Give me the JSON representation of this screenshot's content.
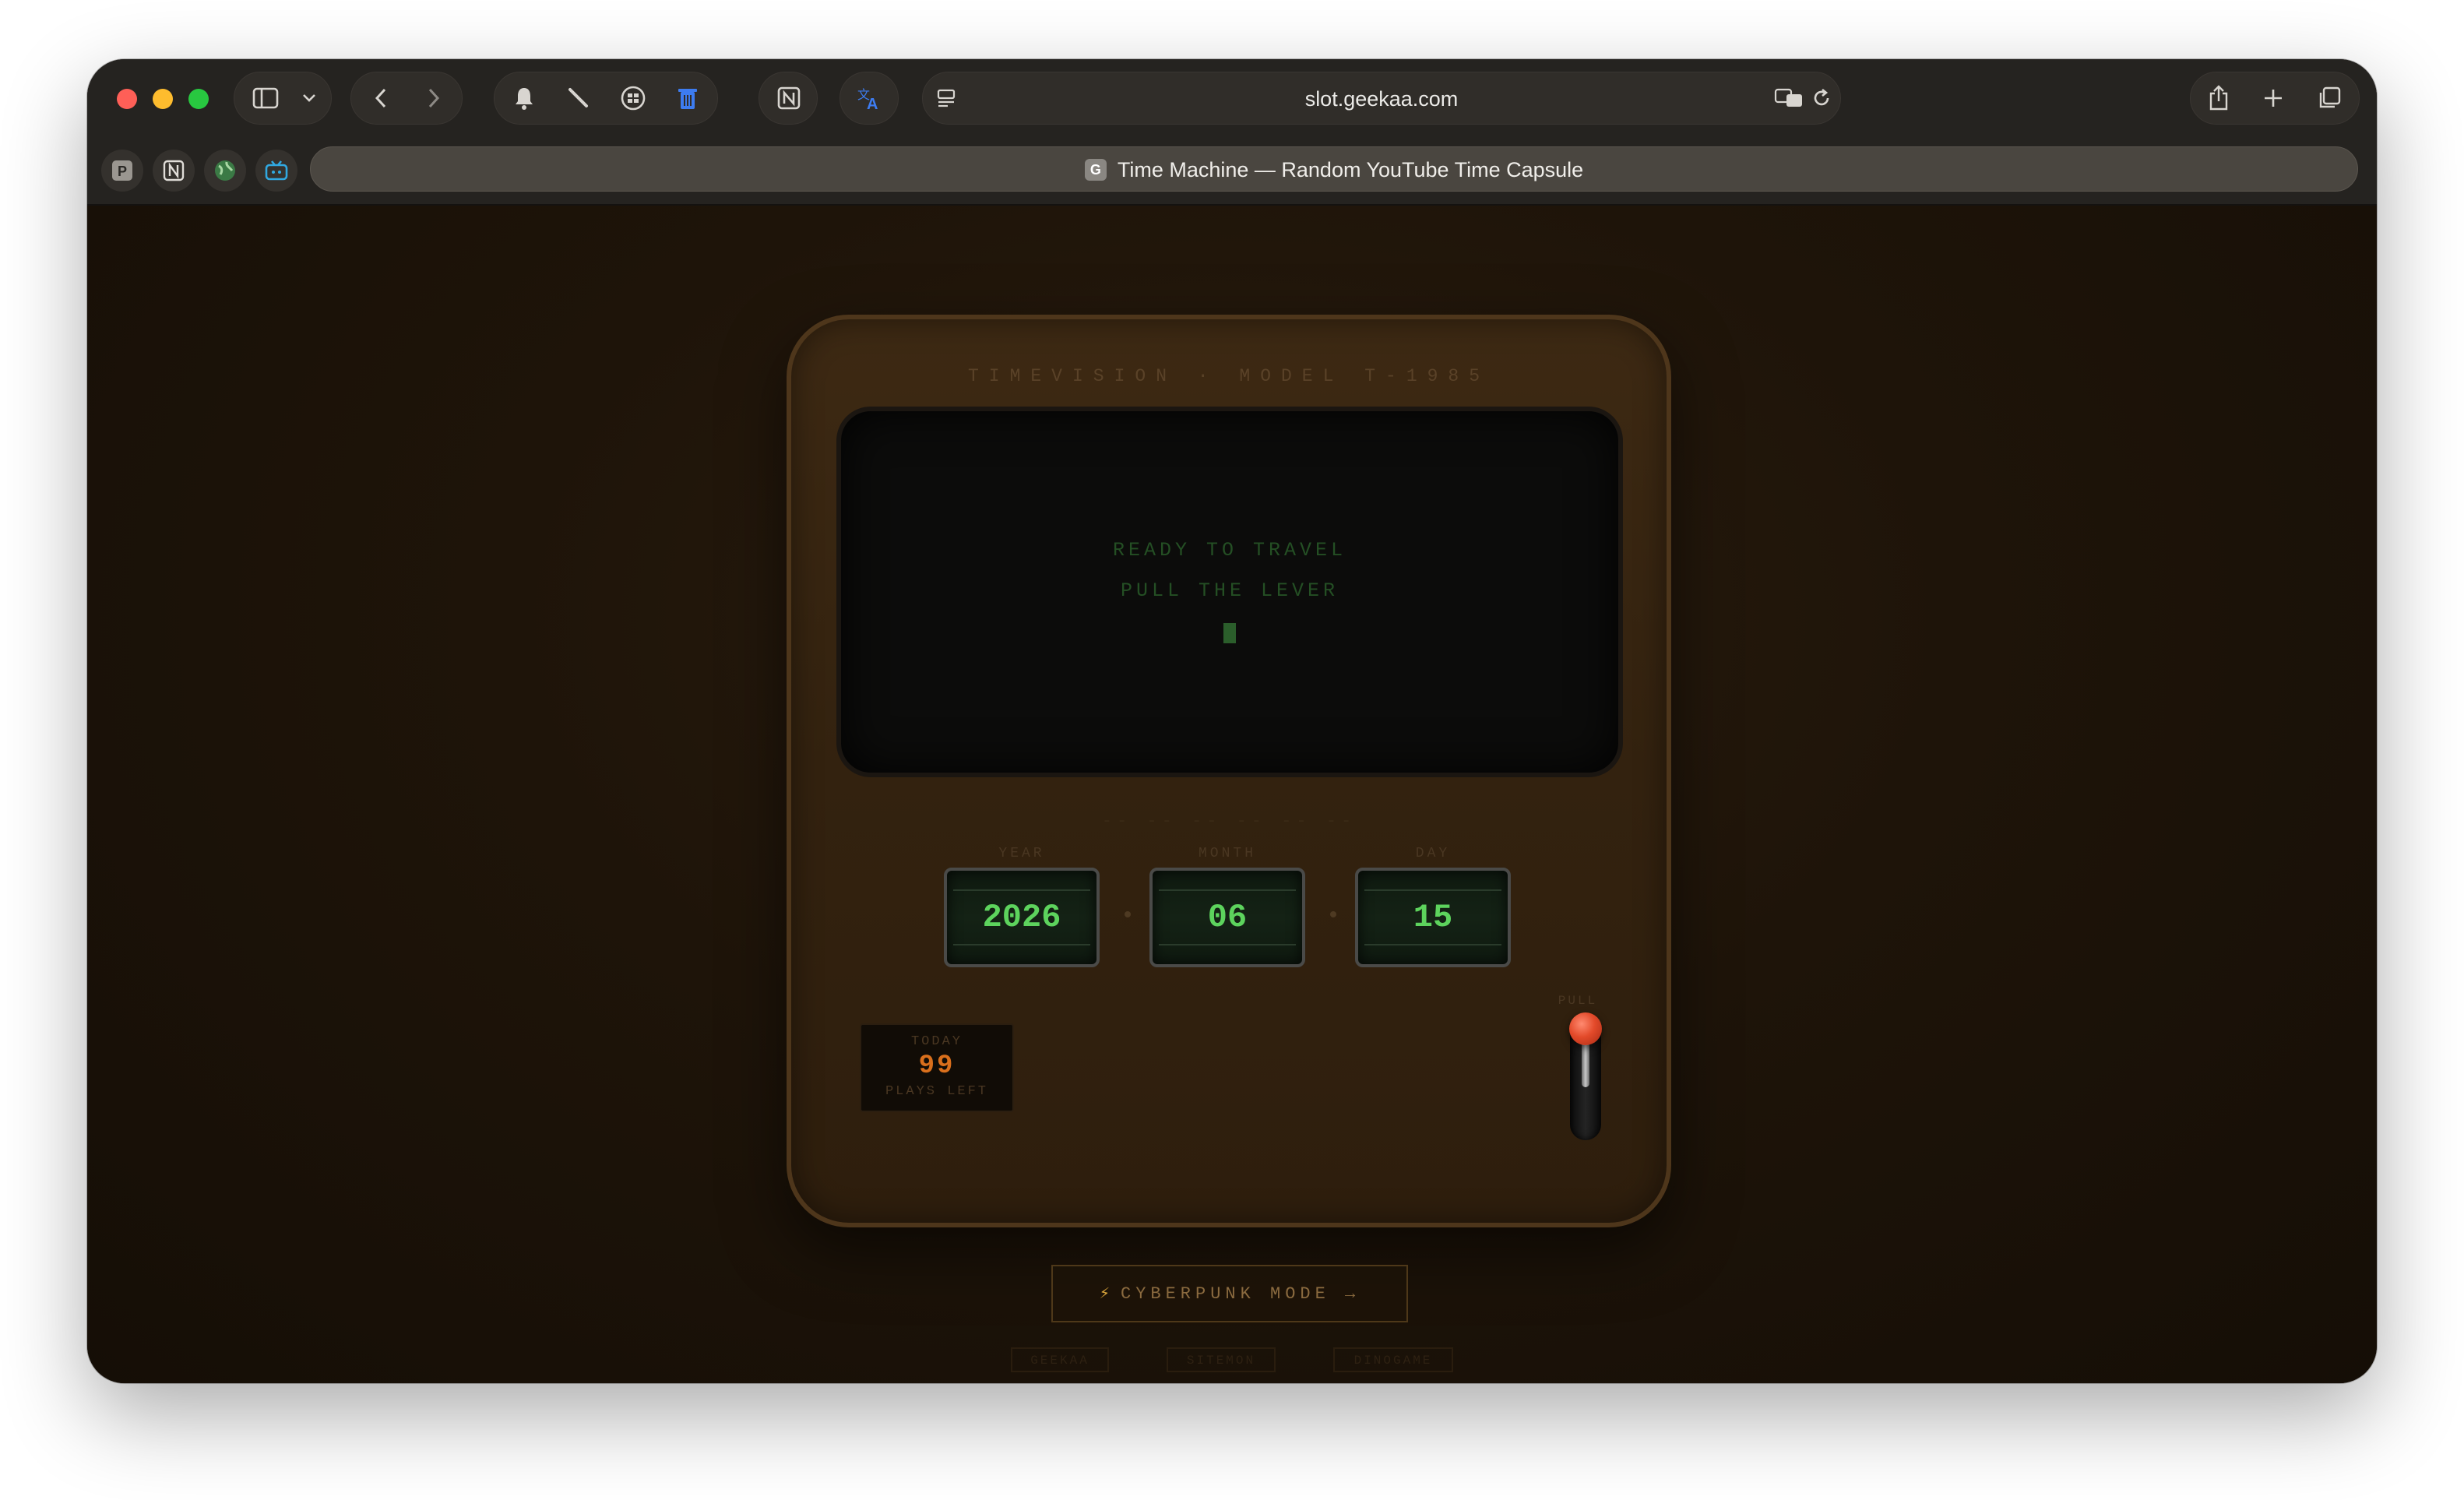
{
  "browser": {
    "url": "slot.geekaa.com",
    "tab_title": "Time Machine — Random YouTube Time Capsule",
    "tab_favicon_letter": "G",
    "pinned_tabs": [
      {
        "name": "P"
      },
      {
        "name": "N"
      },
      {
        "name": "globe"
      },
      {
        "name": "tv"
      }
    ]
  },
  "machine": {
    "model_label": "TIMEVISION · MODEL T-1985",
    "screen_line1": "READY TO TRAVEL",
    "screen_line2": "PULL THE LEVER",
    "divider": "-- -- -- -- -- --",
    "year_label": "YEAR",
    "month_label": "MONTH",
    "day_label": "DAY",
    "year": "2026",
    "month": "06",
    "day": "15",
    "counter_top": "TODAY",
    "counter_value": "99",
    "counter_bottom": "PLAYS LEFT",
    "lever_label": "PULL"
  },
  "cyber_button": {
    "icon": "⚡",
    "label": "CYBERPUNK MODE →"
  },
  "footer_links": [
    "GEEKAA",
    "SITEMON",
    "DINOGAME"
  ],
  "colors": {
    "screen_text": "#244f24",
    "dial_digits": "#5dd35d",
    "counter_digits": "#d96f1c",
    "lever_knob": "#e34a2a",
    "cabinet": "#3d2913"
  }
}
